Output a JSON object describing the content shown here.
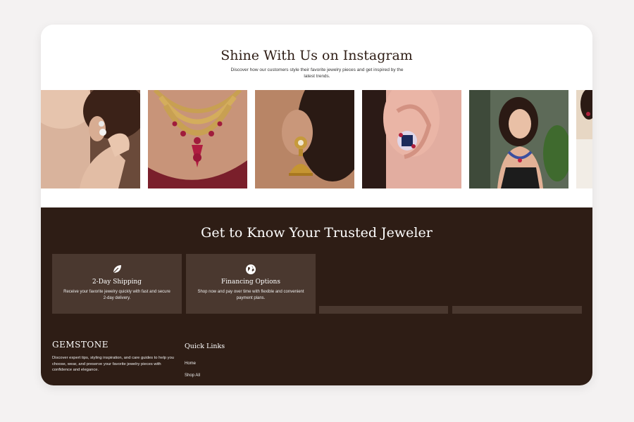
{
  "instagram": {
    "title": "Shine With Us on Instagram",
    "subtitle": "Discover how our customers style their favorite jewelry pieces and get inspired by the latest trends.",
    "photos": [
      {
        "subject": "woman touching earring"
      },
      {
        "subject": "ruby necklace"
      },
      {
        "subject": "gold jhumka earring"
      },
      {
        "subject": "sapphire stud earring"
      },
      {
        "subject": "woman wearing necklace"
      },
      {
        "subject": "partial photo"
      }
    ]
  },
  "about": {
    "title": "Get to Know Your Trusted Jeweler",
    "features": [
      {
        "icon": "leaf-icon",
        "title": "2-Day Shipping",
        "desc": "Receive your favorite jewelry quickly with fast and secure 2-day delivery."
      },
      {
        "icon": "globe-icon",
        "title": "Financing Options",
        "desc": "Shop now and pay over time with flexible and convenient payment plans."
      }
    ]
  },
  "footer": {
    "brand": "GEMSTONE",
    "description": "Discover expert tips, styling inspiration, and care guides to help you choose, wear, and preserve your favorite jewelry pieces with confidence and elegance.",
    "quick_links_title": "Quick Links",
    "links": [
      "Home",
      "Shop All"
    ]
  },
  "colors": {
    "dark_bg": "#2e1d15",
    "card_bg": "#4a382f",
    "accent": "#7a1f2b"
  }
}
